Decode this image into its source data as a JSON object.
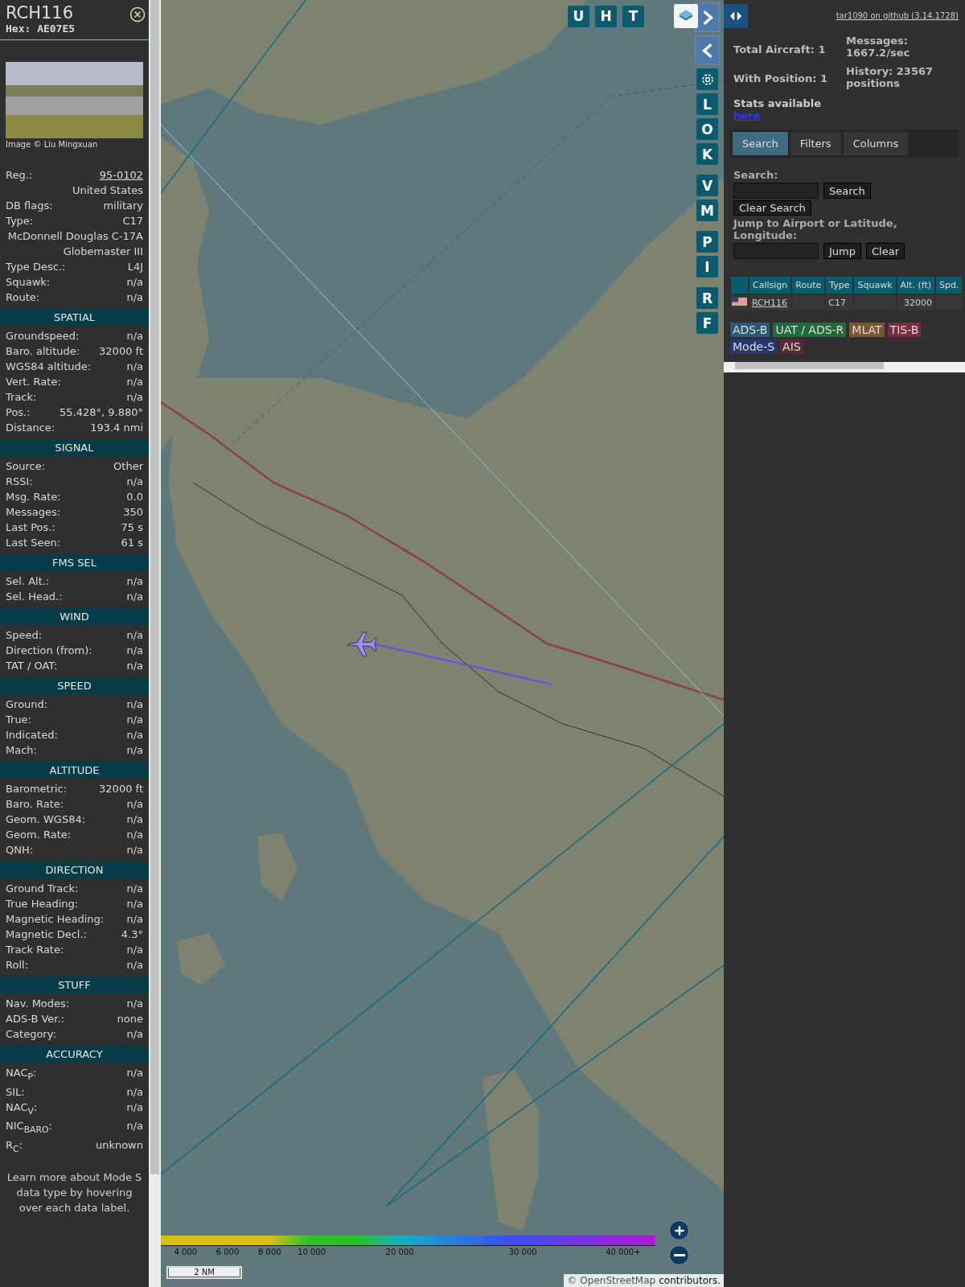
{
  "aircraft": {
    "callsign": "RCH116",
    "hex": "Hex: AE07E5",
    "photo_credit": "Image © Liu Mingxuan",
    "rows": [
      {
        "label": "Reg.:",
        "value": "95-0102",
        "link": true
      },
      {
        "value": "United States",
        "link": false
      },
      {
        "label": "DB flags:",
        "value": "military",
        "link": false
      },
      {
        "label": "Type:",
        "value": "C17",
        "link": false
      },
      {
        "value": "McDonnell Douglas C-17A Globemaster III",
        "link": false
      },
      {
        "label": "Type Desc.:",
        "value": "L4J",
        "link": false
      },
      {
        "label": "Squawk:",
        "value": "n/a",
        "link": false
      },
      {
        "label": "Route:",
        "value": "n/a",
        "link": false
      }
    ]
  },
  "sections": [
    {
      "title": "SPATIAL",
      "rows": [
        {
          "label": "Groundspeed:",
          "value": "n/a"
        },
        {
          "label": "Baro. altitude:",
          "value": "32000 ft"
        },
        {
          "label": "WGS84 altitude:",
          "value": "n/a"
        },
        {
          "label": "Vert. Rate:",
          "value": "n/a"
        },
        {
          "label": "Track:",
          "value": "n/a"
        },
        {
          "label": "Pos.:",
          "value": "55.428°, 9.880°"
        },
        {
          "label": "Distance:",
          "value": "193.4 nmi"
        }
      ]
    },
    {
      "title": "SIGNAL",
      "rows": [
        {
          "label": "Source:",
          "value": "Other"
        },
        {
          "label": "RSSI:",
          "value": "n/a"
        },
        {
          "label": "Msg. Rate:",
          "value": "0.0"
        },
        {
          "label": "Messages:",
          "value": "350"
        },
        {
          "label": "Last Pos.:",
          "value": "75 s"
        },
        {
          "label": "Last Seen:",
          "value": "61 s"
        }
      ]
    },
    {
      "title": "FMS SEL",
      "rows": [
        {
          "label": "Sel. Alt.:",
          "value": "n/a"
        },
        {
          "label": "Sel. Head.:",
          "value": "n/a"
        }
      ]
    },
    {
      "title": "WIND",
      "rows": [
        {
          "label": "Speed:",
          "value": "n/a"
        },
        {
          "label": "Direction (from):",
          "value": "n/a"
        },
        {
          "label": "TAT / OAT:",
          "value": "n/a"
        }
      ]
    },
    {
      "title": "SPEED",
      "rows": [
        {
          "label": "Ground:",
          "value": "n/a"
        },
        {
          "label": "True:",
          "value": "n/a"
        },
        {
          "label": "Indicated:",
          "value": "n/a"
        },
        {
          "label": "Mach:",
          "value": "n/a"
        }
      ]
    },
    {
      "title": "ALTITUDE",
      "rows": [
        {
          "label": "Barometric:",
          "value": "32000 ft"
        },
        {
          "label": "Baro. Rate:",
          "value": "n/a"
        },
        {
          "label": "Geom. WGS84:",
          "value": "n/a"
        },
        {
          "label": "Geom. Rate:",
          "value": "n/a"
        },
        {
          "label": "QNH:",
          "value": "n/a"
        }
      ]
    },
    {
      "title": "DIRECTION",
      "rows": [
        {
          "label": "Ground Track:",
          "value": "n/a"
        },
        {
          "label": "True Heading:",
          "value": "n/a"
        },
        {
          "label": "Magnetic Heading:",
          "value": "n/a"
        },
        {
          "label": "Magnetic Decl.:",
          "value": "4.3°"
        },
        {
          "label": "Track Rate:",
          "value": "n/a"
        },
        {
          "label": "Roll:",
          "value": "n/a"
        }
      ]
    },
    {
      "title": "STUFF",
      "rows": [
        {
          "label": "Nav. Modes:",
          "value": "n/a"
        },
        {
          "label": "ADS-B Ver.:",
          "value": "none"
        },
        {
          "label": "Category:",
          "value": "n/a"
        }
      ]
    },
    {
      "title": "ACCURACY",
      "rows": [
        {
          "label": "NAC$_{P}$:",
          "value": "n/a"
        },
        {
          "label": "SIL:",
          "value": "n/a"
        },
        {
          "label": "NAC$_{V}$:",
          "value": "n/a"
        },
        {
          "label": "NIC$_{BARO}$:",
          "value": "n/a"
        },
        {
          "label": "R$_{C}$:",
          "value": "unknown"
        }
      ]
    }
  ],
  "info_note": "Learn more about Mode S data type by hovering over each data label.",
  "map": {
    "top_buttons": [
      "U",
      "H",
      "T"
    ],
    "side_buttons": [
      "L",
      "O",
      "K",
      "V",
      "M",
      "P",
      "I",
      "R",
      "F"
    ],
    "legend": [
      "4 000",
      "6 000",
      "8 000",
      "10 000",
      "20 000",
      "30 000",
      "40 000+"
    ],
    "scale": "2 NM",
    "attribution": {
      "prefix": "©",
      "link": "OpenStreetMap",
      "suffix": "contributors."
    }
  },
  "panel": {
    "github": "tar1090 on github (3.14.1728)",
    "stats": {
      "total": "Total Aircraft: 1",
      "with_position": "With Position: 1",
      "messages": "Messages: 1667.2/sec",
      "history": "History: 23567 positions",
      "stats_label": "Stats available",
      "stats_link": "here"
    },
    "tabs": [
      {
        "label": "Search",
        "selected": true
      },
      {
        "label": "Filters",
        "selected": false
      },
      {
        "label": "Columns",
        "selected": false
      }
    ],
    "search_label": "Search:",
    "search_button": "Search",
    "clear_search_button": "Clear Search",
    "jump_label": "Jump to Airport or Latitude, Longitude:",
    "jump_button": "Jump",
    "clear_button": "Clear",
    "table": {
      "columns": [
        "Callsign",
        "Route",
        "Type",
        "Squawk",
        "Alt. (ft)",
        "Spd."
      ],
      "rows": [
        {
          "callsign": "RCH116",
          "type": "C17",
          "altitude": "32000"
        }
      ]
    },
    "sources": [
      {
        "label": "ADS-B",
        "color": "#2b5876"
      },
      {
        "label": "UAT / ADS-R",
        "color": "#216a3c"
      },
      {
        "label": "MLAT",
        "color": "#7a5530"
      },
      {
        "label": "TIS-B",
        "color": "#7a2c40"
      },
      {
        "label": "Mode-S",
        "color": "#28386e"
      },
      {
        "label": "AIS",
        "color": "#5a2838"
      }
    ]
  }
}
